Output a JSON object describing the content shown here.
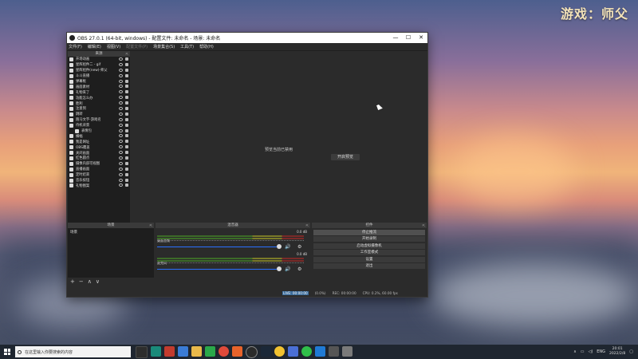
{
  "watermark": "游戏：师父",
  "obs": {
    "title": "OBS 27.0.1 (64-bit, windows) - 配置文件: 未命名 - 场景: 未命名",
    "window_controls": {
      "minimize": "—",
      "maximize": "☐",
      "close": "✕"
    },
    "menu": [
      "文件(F)",
      "编辑(E)",
      "视图(V)",
      "配置文件(P)",
      "场景集合(S)",
      "工具(T)",
      "帮助(H)"
    ],
    "sources_header": "来源",
    "sources": [
      {
        "label": "开场动画",
        "indent": false
      },
      {
        "label": "星辉组件二 - gif",
        "indent": false
      },
      {
        "label": "星辉组件(new)-师父",
        "indent": false
      },
      {
        "label": "斗斗直播",
        "indent": false
      },
      {
        "label": "弹幕框",
        "indent": false
      },
      {
        "label": "画面素材",
        "indent": false
      },
      {
        "label": "礼物来了",
        "indent": false
      },
      {
        "label": "功能怎么办",
        "indent": false
      },
      {
        "label": "胜利",
        "indent": false
      },
      {
        "label": "注意到",
        "indent": false
      },
      {
        "label": "跳转",
        "indent": false
      },
      {
        "label": "跑马文字-游戏名",
        "indent": false
      },
      {
        "label": "待机背景",
        "indent": false
      },
      {
        "label": "表情包",
        "indent": true
      },
      {
        "label": "横幅",
        "indent": false
      },
      {
        "label": "我是网址",
        "indent": false
      },
      {
        "label": "OBS覆盖",
        "indent": false
      },
      {
        "label": "关闭画面",
        "indent": false
      },
      {
        "label": "红色圆点",
        "indent": false
      },
      {
        "label": "摄像内部可视图",
        "indent": false
      },
      {
        "label": "直播画面",
        "indent": false
      },
      {
        "label": "定时结束",
        "indent": false
      },
      {
        "label": "音乐按钮",
        "indent": false
      },
      {
        "label": "礼物图案",
        "indent": false
      }
    ],
    "source_tools": [
      "+",
      "−",
      "⚙",
      "∧",
      "∨"
    ],
    "preview": {
      "message": "预览当前已禁用",
      "button": "开启预览"
    },
    "scenes_header": "场景",
    "scenes": [
      "场景"
    ],
    "scene_tools": [
      "+",
      "−",
      "∧",
      "∨"
    ],
    "mixer_header": "混音器",
    "mixer": [
      {
        "name": "桌面音频",
        "db": "0.0 dB"
      },
      {
        "name": "麦克风",
        "db": "0.0 dB"
      }
    ],
    "controls_header": "控件",
    "controls": [
      "停止推流",
      "开始录制",
      "启动虚拟摄像机",
      "工作室模式",
      "设置",
      "退出"
    ],
    "status": {
      "live_label": "LIVE:",
      "live_time": "00:00:00",
      "rec_label": "REC:",
      "rec_time": "00:00:00",
      "cpu": "CPU: 0.2%, 60.00 fps",
      "drop": "(0.0%)"
    }
  },
  "taskbar": {
    "search_placeholder": "在这里输入你要搜索的内容",
    "ime": "ENG",
    "time": "20:01",
    "date": "2022/2/8"
  },
  "colors": {
    "accent_blue": "#2a70ff",
    "panel": "#2b2b2b",
    "dark": "#1e1e1e"
  }
}
